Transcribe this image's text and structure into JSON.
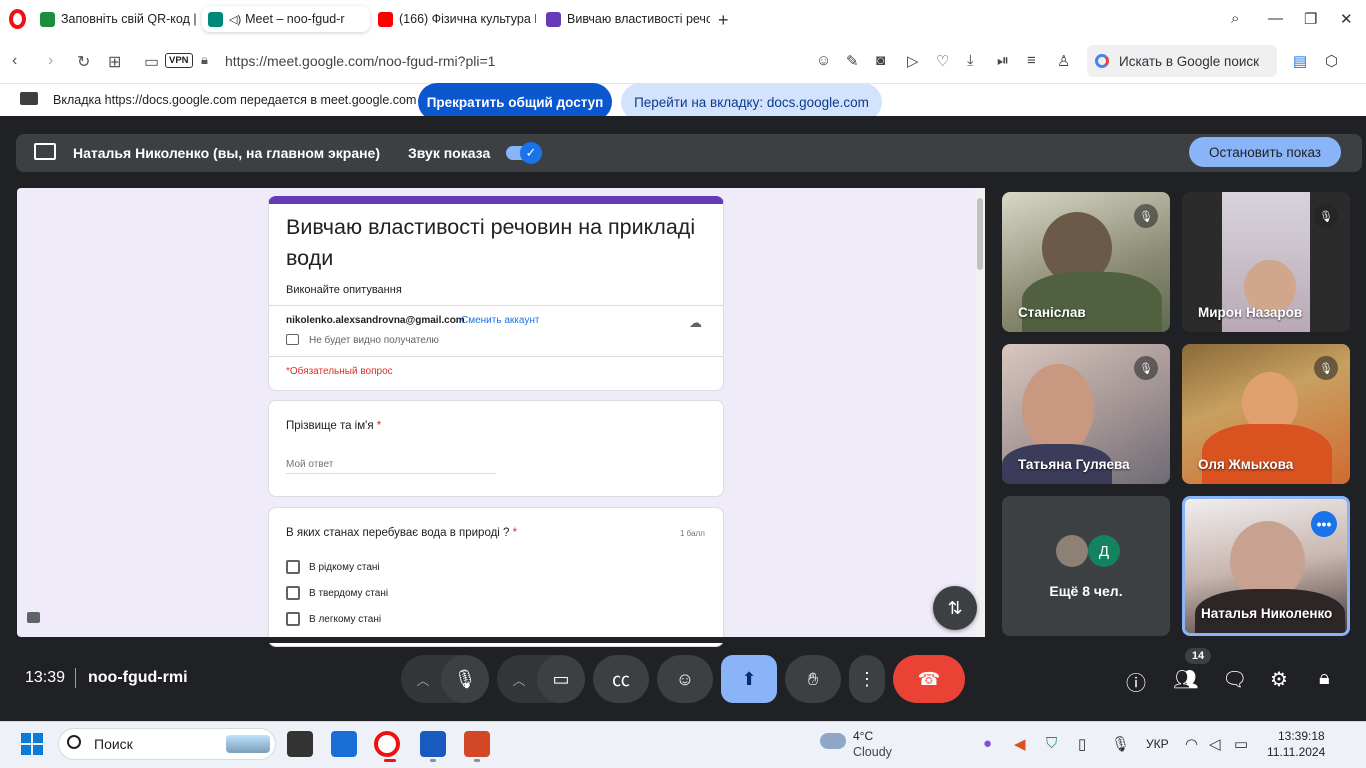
{
  "browser": {
    "tabs": [
      {
        "title": "Заповніть свій QR-код | C",
        "color": "#1e8e3e"
      },
      {
        "title": "Meet – noo-fgud-r",
        "color": "#00897b"
      },
      {
        "title": "(166) Фізична культура Н",
        "color": "#ff0000"
      },
      {
        "title": "Вивчаю властивості речо",
        "color": "#673ab7"
      }
    ],
    "vpn_label": "VPN",
    "url": "https://meet.google.com/noo-fgud-rmi?pli=1",
    "search_placeholder": "Искать в Google поиск"
  },
  "share_notice": {
    "text": "Вкладка https://docs.google.com передается в meet.google.com",
    "stop_label": "Прекратить общий доступ",
    "goto_label": "Перейти на вкладку: docs.google.com"
  },
  "presentation": {
    "presenter_label": "Наталья Николенко (вы, на главном экране)",
    "audio_label": "Звук показа",
    "audio_on": true,
    "stop_label": "Остановить показ"
  },
  "form": {
    "title": "Вивчаю властивості речовин на прикладі води",
    "subtitle": "Виконайте опитування",
    "email": "nikolenko.alexsandrovna@gmail.com",
    "switch_account": "Сменить аккаунт",
    "hidden_note": "Не будет видно получателю",
    "required_note": "*Обязательный вопрос",
    "q1": {
      "label": "Прізвище та ім'я",
      "required_mark": "*",
      "placeholder": "Мой ответ"
    },
    "q2": {
      "label": "В яких станах перебуває вода в природі ?",
      "required_mark": "*",
      "points": "1 балл",
      "options": [
        "В рідкому стані",
        "В твердому стані",
        "В легкому стані"
      ]
    }
  },
  "participants": [
    {
      "name": "Станіслав",
      "muted": true,
      "bg": "#9a9a86"
    },
    {
      "name": "Мирон Назаров",
      "muted": true,
      "bg": "#c8bcc8"
    },
    {
      "name": "Татьяна Гуляева",
      "muted": true,
      "bg": "#b8a8a6"
    },
    {
      "name": "Оля Жмыхова",
      "muted": true,
      "bg": "#c87a3a"
    }
  ],
  "more_tile": {
    "label": "Ещё 8 чел.",
    "avatar_letter": "Д",
    "avatar_color": "#12825f"
  },
  "self_tile": {
    "name": "Наталья Николенко",
    "more_icon": "more-horiz-icon"
  },
  "meeting": {
    "time": "13:39",
    "code": "noo-fgud-rmi",
    "people_count": "14"
  },
  "controls": [
    "mic-icon",
    "camera-icon",
    "captions-icon",
    "emoji-icon",
    "present-icon",
    "raise-hand-icon",
    "more-vert-icon",
    "end-call-icon"
  ],
  "taskbar": {
    "search_label": "Поиск",
    "weather_temp": "4°C",
    "weather_desc": "Cloudy",
    "lang": "УКР",
    "time": "13:39:18",
    "date": "11.11.2024"
  }
}
